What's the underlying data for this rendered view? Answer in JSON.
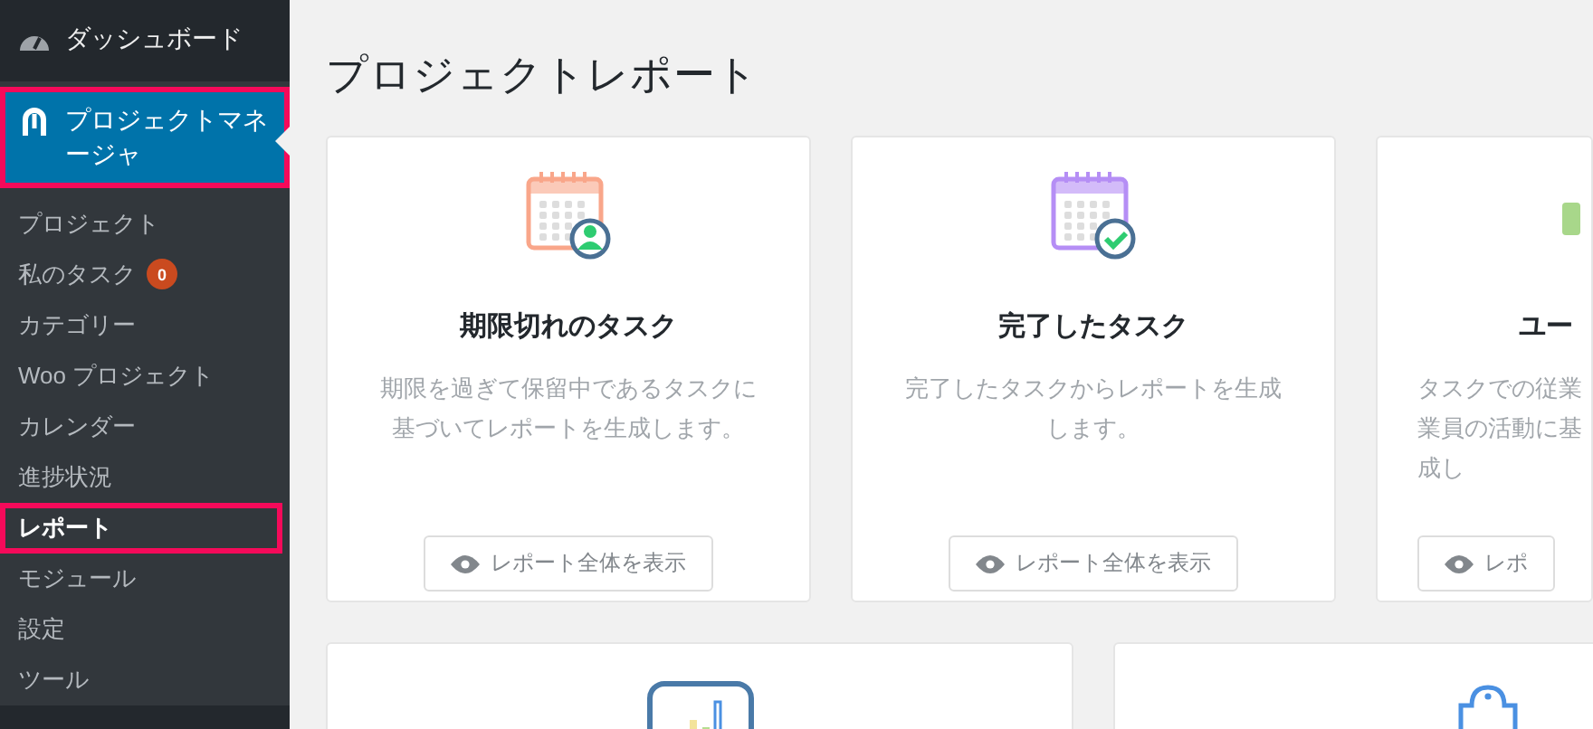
{
  "sidebar": {
    "top_item": {
      "label": "ダッシュボード"
    },
    "current_menu": {
      "label": "プロジェクトマネージャ",
      "highlighted": true
    },
    "submenu": [
      {
        "label": "プロジェクト",
        "selected": false,
        "highlighted": false
      },
      {
        "label": "私のタスク",
        "badge": "0",
        "selected": false,
        "highlighted": false
      },
      {
        "label": "カテゴリー",
        "selected": false,
        "highlighted": false
      },
      {
        "label": "Woo プロジェクト",
        "selected": false,
        "highlighted": false
      },
      {
        "label": "カレンダー",
        "selected": false,
        "highlighted": false
      },
      {
        "label": "進捗状況",
        "selected": false,
        "highlighted": false
      },
      {
        "label": "レポート",
        "selected": true,
        "highlighted": true
      },
      {
        "label": "モジュール",
        "selected": false,
        "highlighted": false
      },
      {
        "label": "設定",
        "selected": false,
        "highlighted": false
      },
      {
        "label": "ツール",
        "selected": false,
        "highlighted": false
      }
    ]
  },
  "page_title": "プロジェクトレポート",
  "report_cards": [
    {
      "kind": "overdue",
      "title": "期限切れのタスク",
      "description": [
        "期限を過ぎて保留中であるタスクに",
        "基づいてレポートを生成します。"
      ],
      "button": "レポート全体を表示"
    },
    {
      "kind": "completed",
      "title": "完了したタスク",
      "description": [
        "完了したタスクからレポートを生成",
        "します。"
      ],
      "button": "レポート全体を表示"
    },
    {
      "kind": "user",
      "title": "ユー",
      "description": [
        "タスクでの従業",
        "業員の活動に基",
        "成し"
      ],
      "button": "レポ"
    }
  ],
  "lower_cards": [
    {
      "kind": "chart"
    },
    {
      "kind": "clipboard"
    }
  ]
}
